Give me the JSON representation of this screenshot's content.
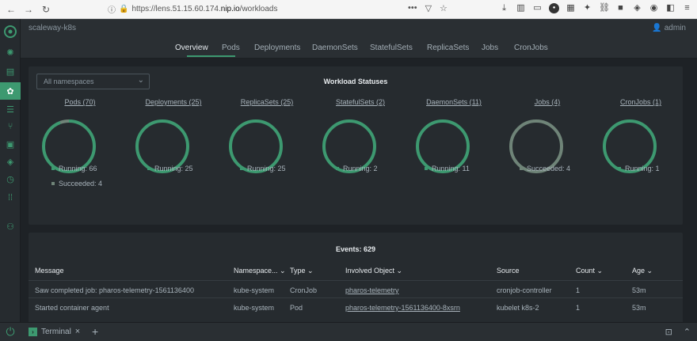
{
  "browser": {
    "url_prefix": "https://lens.51.15.60.174.",
    "url_host": "nip.io",
    "url_path": "/workloads",
    "more_label": "•••"
  },
  "cluster": {
    "name": "scaleway-k8s",
    "user": "admin"
  },
  "tabs": [
    {
      "label": "Overview",
      "active": true
    },
    {
      "label": "Pods"
    },
    {
      "label": "Deployments"
    },
    {
      "label": "DaemonSets"
    },
    {
      "label": "StatefulSets"
    },
    {
      "label": "ReplicaSets"
    },
    {
      "label": "Jobs"
    },
    {
      "label": "CronJobs"
    }
  ],
  "namespace_select": {
    "value": "All namespaces"
  },
  "status_panel": {
    "title": "Workload Statuses"
  },
  "workloads": [
    {
      "title": "Pods (70)",
      "legend": [
        {
          "label": "Running: 66",
          "color": "#3d9970"
        },
        {
          "label": "Succeeded: 4",
          "color": "#6f8478"
        }
      ]
    },
    {
      "title": "Deployments (25)",
      "legend": [
        {
          "label": "Running: 25",
          "color": "#3d9970"
        }
      ]
    },
    {
      "title": "ReplicaSets (25)",
      "legend": [
        {
          "label": "Running: 25",
          "color": "#3d9970"
        }
      ]
    },
    {
      "title": "StatefulSets (2)",
      "legend": [
        {
          "label": "Running: 2",
          "color": "#3d9970"
        }
      ]
    },
    {
      "title": "DaemonSets (11)",
      "legend": [
        {
          "label": "Running: 11",
          "color": "#3d9970"
        }
      ]
    },
    {
      "title": "Jobs (4)",
      "legend": [
        {
          "label": "Succeeded: 4",
          "color": "#6f8478"
        }
      ]
    },
    {
      "title": "CronJobs (1)",
      "legend": [
        {
          "label": "Running: 1",
          "color": "#3d9970"
        }
      ]
    }
  ],
  "events": {
    "title": "Events: 629",
    "columns": [
      "Message",
      "Namespace",
      "Type",
      "Involved Object",
      "Source",
      "Count",
      "Age"
    ],
    "rows": [
      [
        "Saw completed job: pharos-telemetry-1561136400",
        "kube-system",
        "CronJob",
        "pharos-telemetry",
        "cronjob-controller",
        "1",
        "53m"
      ],
      [
        "Started container agent",
        "kube-system",
        "Pod",
        "pharos-telemetry-1561136400-8xsrn",
        "kubelet k8s-2",
        "1",
        "53m"
      ]
    ]
  },
  "bottom": {
    "terminal_label": "Terminal"
  },
  "colors": {
    "accent": "#3d9970",
    "succeeded": "#6f8478",
    "background": "#1e2124",
    "panel": "#262b2f"
  }
}
